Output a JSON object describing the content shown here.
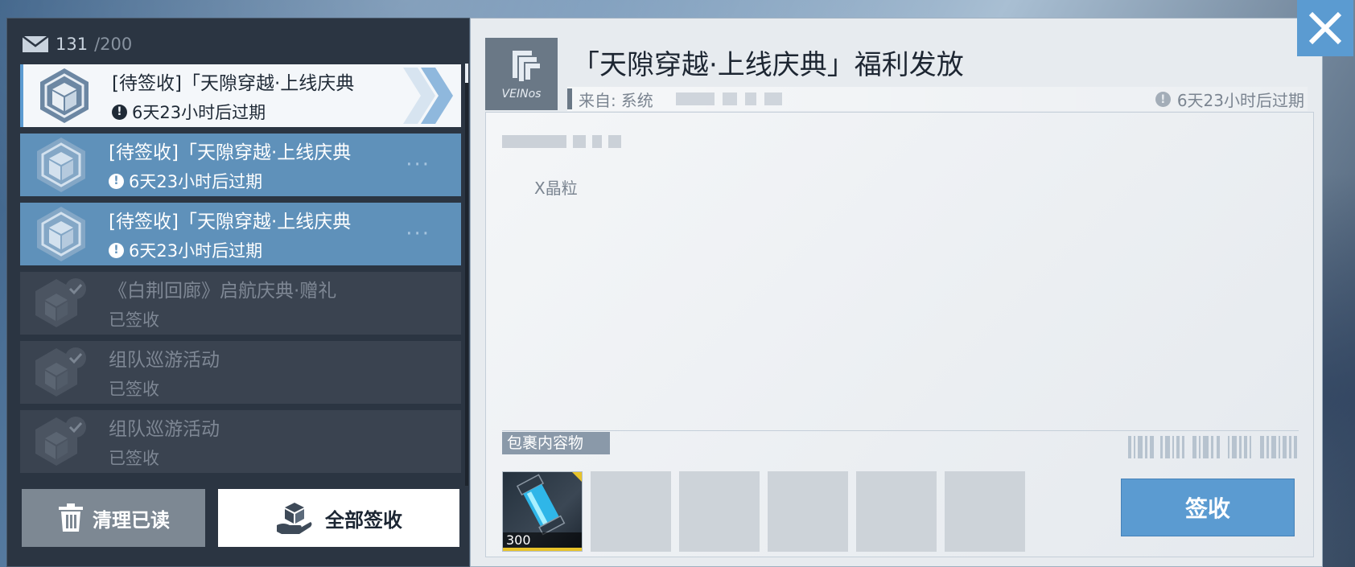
{
  "mailbox": {
    "count": "131",
    "max": "/200"
  },
  "mails": [
    {
      "subject": "[待签收]「天隙穿越·上线庆典",
      "status": "6天23小时后过期",
      "state": "selected"
    },
    {
      "subject": "[待签收]「天隙穿越·上线庆典",
      "status": "6天23小时后过期",
      "state": "pending"
    },
    {
      "subject": "[待签收]「天隙穿越·上线庆典",
      "status": "6天23小时后过期",
      "state": "pending"
    },
    {
      "subject": "《白荆回廊》启航庆典·赠礼",
      "status": "已签收",
      "state": "read"
    },
    {
      "subject": "组队巡游活动",
      "status": "已签收",
      "state": "read"
    },
    {
      "subject": "组队巡游活动",
      "status": "已签收",
      "state": "read"
    }
  ],
  "buttons": {
    "clear_read": "清理已读",
    "claim_all": "全部签收",
    "claim": "签收"
  },
  "detail": {
    "title": "「天隙穿越·上线庆典」福利发放",
    "from_label": "来自:",
    "from_value": "系统",
    "expire": "6天23小时后过期",
    "sender_logo_text": "VEINos",
    "body_text": "X晶粒",
    "attachments_label": "包裹内容物",
    "attachments": [
      {
        "qty": "300",
        "filled": true
      },
      {
        "filled": false
      },
      {
        "filled": false
      },
      {
        "filled": false
      },
      {
        "filled": false
      },
      {
        "filled": false
      }
    ]
  },
  "colors": {
    "accent": "#5b9bd1",
    "pending_item": "#5f91ba",
    "read_item": "#3a4350",
    "panel_dark": "#2b3542"
  }
}
